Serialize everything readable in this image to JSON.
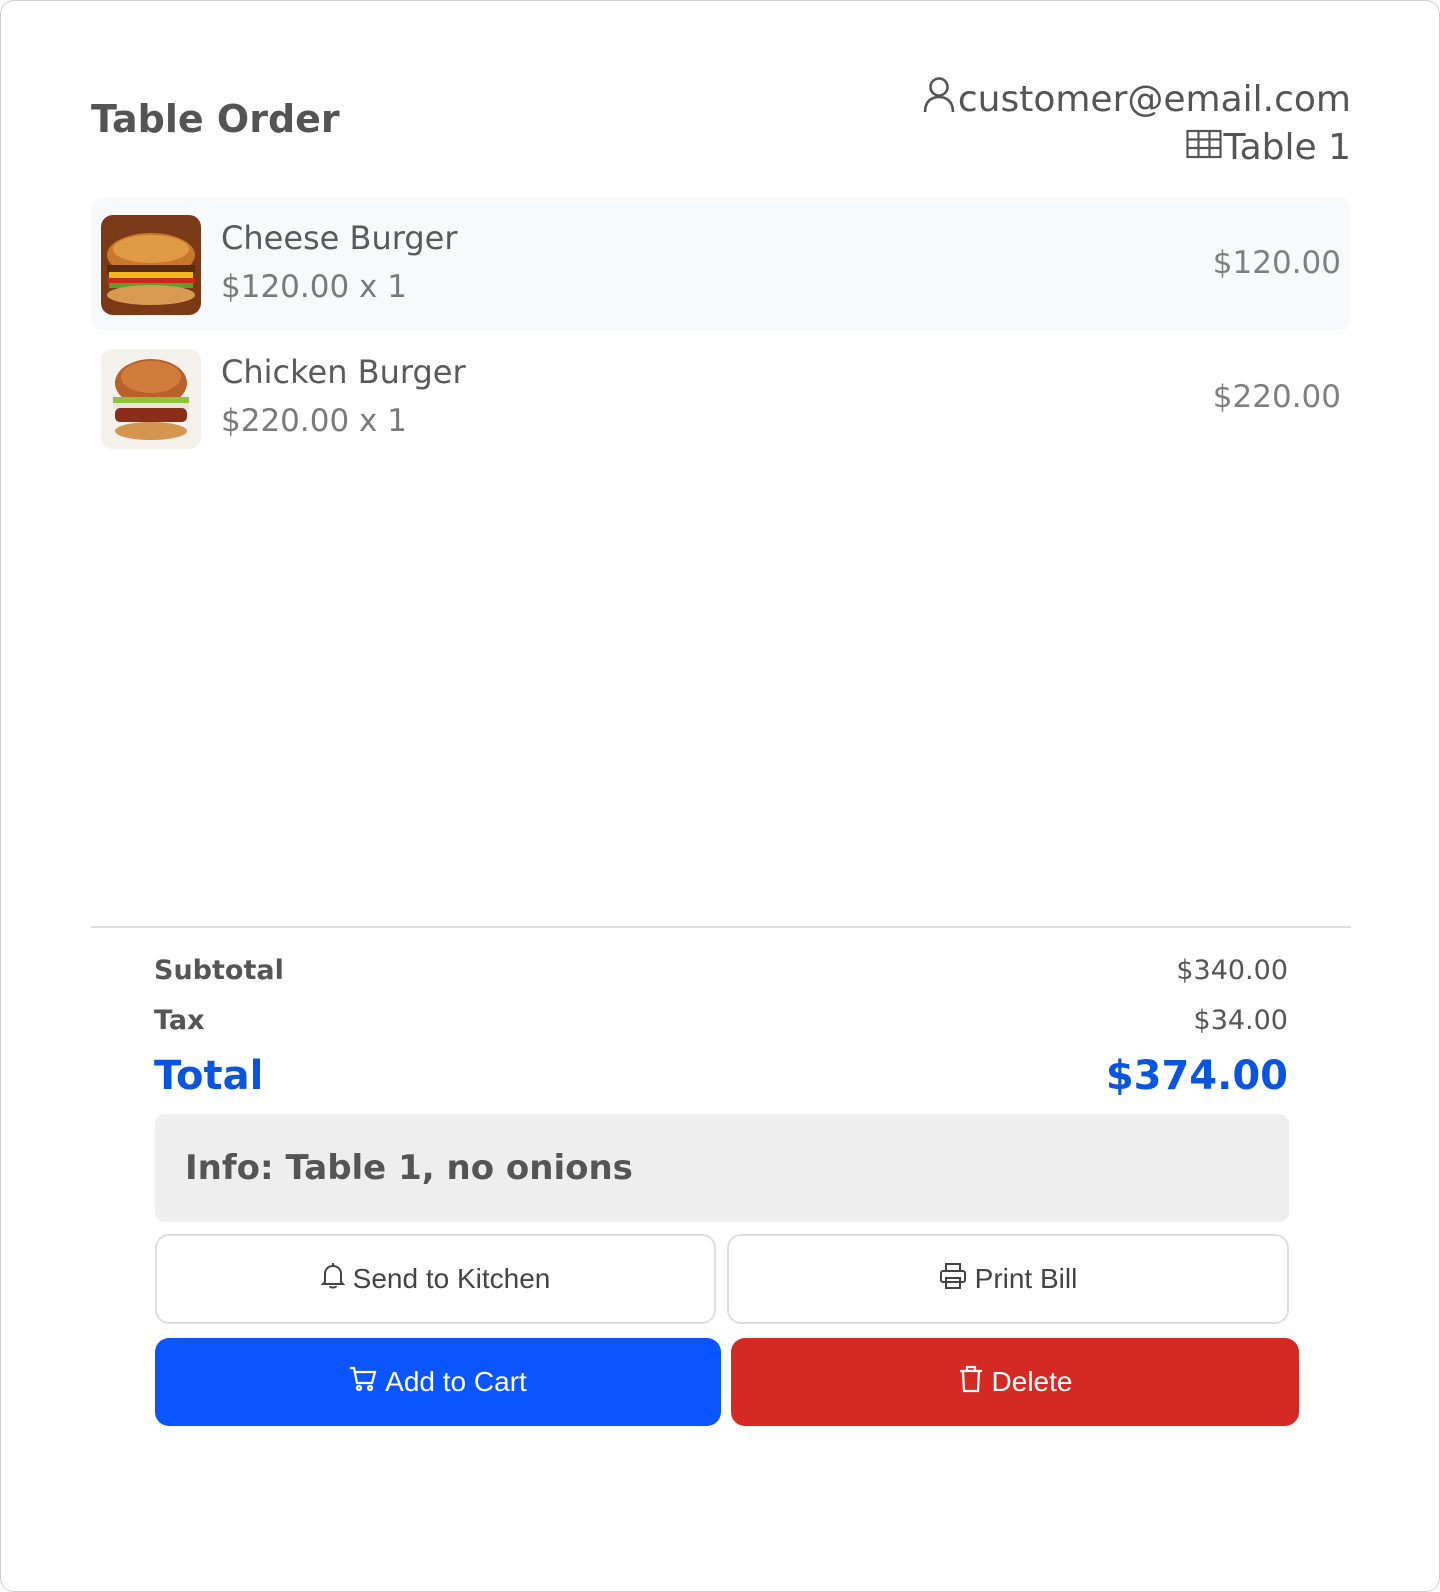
{
  "header": {
    "title": "Table Order",
    "user_email": "customer@email.com",
    "table_label": "Table 1"
  },
  "order_items": [
    {
      "name": "Cheese Burger",
      "unit_line": "$120.00 x 1",
      "line_total": "$120.00",
      "image": "cheese-burger-photo"
    },
    {
      "name": "Chicken Burger",
      "unit_line": "$220.00 x 1",
      "line_total": "$220.00",
      "image": "chicken-burger-photo"
    }
  ],
  "summary": {
    "subtotal_label": "Subtotal",
    "subtotal_value": "$340.00",
    "tax_label": "Tax",
    "tax_value": "$34.00",
    "total_label": "Total",
    "total_value": "$374.00"
  },
  "info": {
    "text": "Info: Table 1, no onions"
  },
  "actions": {
    "send_kitchen_label": "Send to Kitchen",
    "print_bill_label": "Print Bill",
    "add_cart_label": "Add to Cart",
    "delete_label": "Delete"
  },
  "colors": {
    "accent_blue": "#0a55ff",
    "danger_red": "#d42a23",
    "total_blue": "#0a55e0"
  },
  "icons": [
    "user-icon",
    "table-grid-icon",
    "bell-icon",
    "printer-icon",
    "cart-icon",
    "trash-icon"
  ]
}
